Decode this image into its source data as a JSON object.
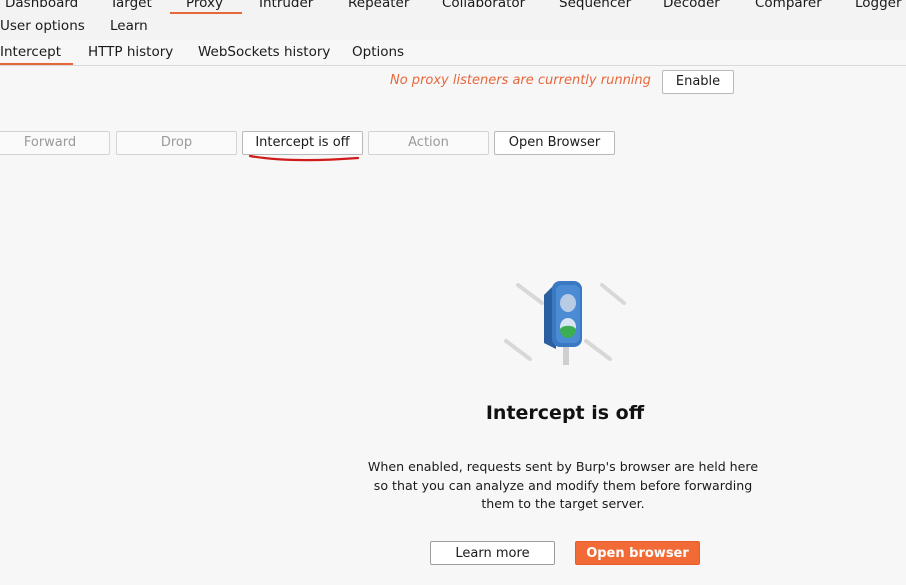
{
  "nav": {
    "row1": [
      "Dashboard",
      "Target",
      "Proxy",
      "Intruder",
      "Repeater",
      "Collaborator",
      "Sequencer",
      "Decoder",
      "Comparer",
      "Logger"
    ],
    "row2": [
      "User options",
      "Learn"
    ],
    "active": "Proxy"
  },
  "subtabs": [
    "Intercept",
    "HTTP history",
    "WebSockets history",
    "Options"
  ],
  "status": {
    "message": "No proxy listeners are currently running",
    "enable_label": "Enable"
  },
  "toolbar": {
    "forward": "Forward",
    "drop": "Drop",
    "intercept": "Intercept is off",
    "action": "Action",
    "open_browser": "Open Browser"
  },
  "panel": {
    "title": "Intercept is off",
    "description": "When enabled, requests sent by Burp's browser are held here so that you can analyze and modify them before forwarding them to the target server.",
    "learn_more": "Learn more",
    "open_browser": "Open browser",
    "icon": "traffic-light-icon"
  },
  "colors": {
    "accent": "#f26a35",
    "annotation": "#d11a1a"
  }
}
